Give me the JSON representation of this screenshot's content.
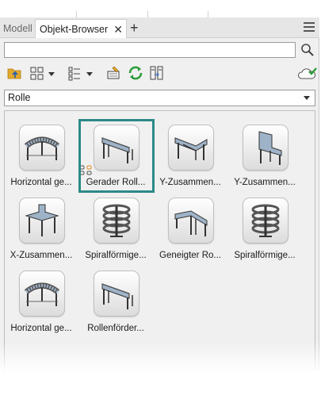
{
  "tabs": {
    "inactive_label": "Modell",
    "active_label": "Objekt-Browser",
    "close_glyph": "✕",
    "add_glyph": "+"
  },
  "search": {
    "value": "",
    "placeholder": ""
  },
  "toolbar": {
    "icons": [
      "folder-up-icon",
      "large-icons-view-icon",
      "list-view-icon",
      "edit-icon",
      "refresh-icon",
      "columns-icon",
      "cloud-check-icon"
    ]
  },
  "category": {
    "selected": "Rolle"
  },
  "items": [
    {
      "label": "Horizontal ge...",
      "type": "curved"
    },
    {
      "label": "Gerader Roll...",
      "type": "straight",
      "selected": true
    },
    {
      "label": "Y-Zusammen...",
      "type": "ymerge"
    },
    {
      "label": "Y-Zusammen...",
      "type": "ymerge2"
    },
    {
      "label": "X-Zusammen...",
      "type": "xmerge"
    },
    {
      "label": "Spiralförmige...",
      "type": "spiral"
    },
    {
      "label": "Geneigter Ro...",
      "type": "inclined"
    },
    {
      "label": "Spiralförmige...",
      "type": "spiral"
    },
    {
      "label": "Horizontal ge...",
      "type": "curved"
    },
    {
      "label": "Rollenförder...",
      "type": "straight"
    }
  ],
  "colors": {
    "selection": "#2b8a87",
    "refresh": "#2a9d3a",
    "folder": "#e3a92b"
  }
}
